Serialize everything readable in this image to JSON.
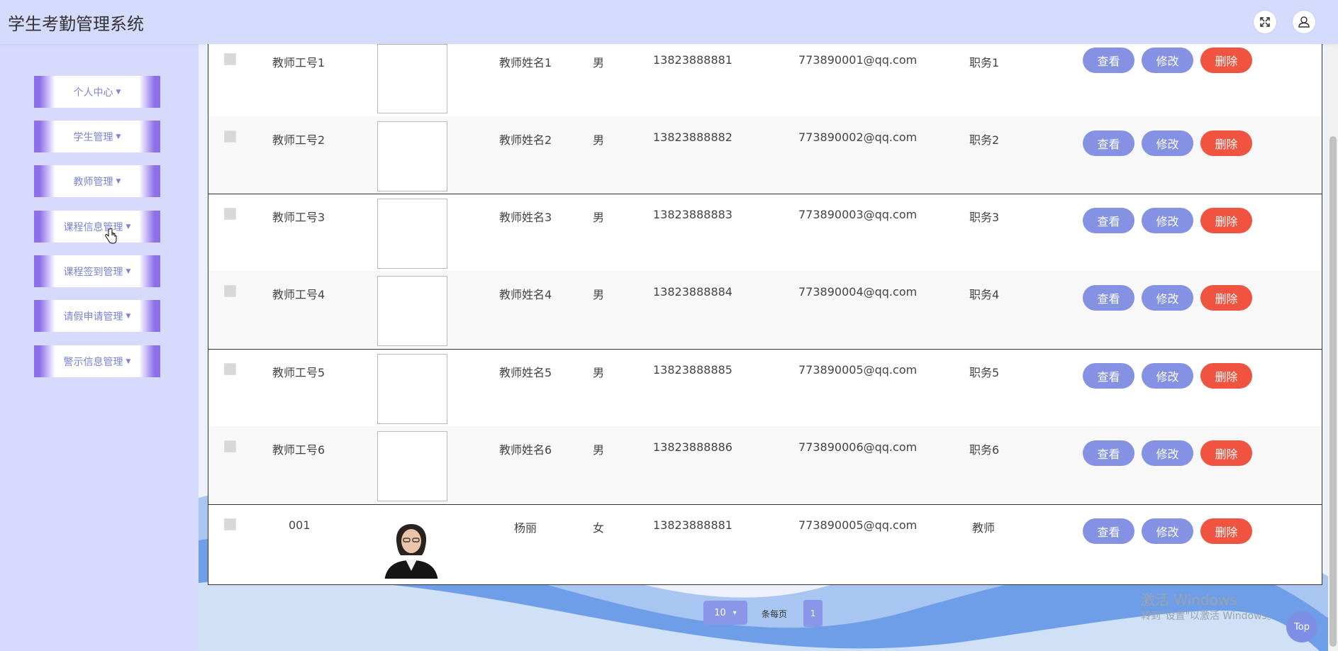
{
  "header": {
    "title": "学生考勤管理系统",
    "fullscreen_icon": "expand-icon",
    "user_icon": "user-icon"
  },
  "sidebar": {
    "items": [
      {
        "label": "个人中心"
      },
      {
        "label": "学生管理"
      },
      {
        "label": "教师管理"
      },
      {
        "label": "课程信息管理"
      },
      {
        "label": "课程签到管理"
      },
      {
        "label": "请假申请管理"
      },
      {
        "label": "警示信息管理"
      }
    ]
  },
  "table": {
    "rows": [
      {
        "id": "教师工号1",
        "name": "教师姓名1",
        "gender": "男",
        "phone": "13823888881",
        "email": "773890001@qq.com",
        "title": "职务1"
      },
      {
        "id": "教师工号2",
        "name": "教师姓名2",
        "gender": "男",
        "phone": "13823888882",
        "email": "773890002@qq.com",
        "title": "职务2"
      },
      {
        "id": "教师工号3",
        "name": "教师姓名3",
        "gender": "男",
        "phone": "13823888883",
        "email": "773890003@qq.com",
        "title": "职务3"
      },
      {
        "id": "教师工号4",
        "name": "教师姓名4",
        "gender": "男",
        "phone": "13823888884",
        "email": "773890004@qq.com",
        "title": "职务4"
      },
      {
        "id": "教师工号5",
        "name": "教师姓名5",
        "gender": "男",
        "phone": "13823888885",
        "email": "773890005@qq.com",
        "title": "职务5"
      },
      {
        "id": "教师工号6",
        "name": "教师姓名6",
        "gender": "男",
        "phone": "13823888886",
        "email": "773890006@qq.com",
        "title": "职务6"
      },
      {
        "id": "001",
        "name": "杨丽",
        "gender": "女",
        "phone": "13823888881",
        "email": "773890005@qq.com",
        "title": "教师"
      }
    ],
    "actions": {
      "view": "查看",
      "edit": "修改",
      "delete": "删除"
    }
  },
  "pagination": {
    "page_size": "10",
    "per_page_label": "条每页",
    "current_page": "1"
  },
  "watermark": {
    "line1": "激活 Windows",
    "line2": "转到\"设置\"以激活 Windows。"
  },
  "top_button": "Top",
  "colors": {
    "header_bg": "#d5dbfd",
    "sidebar_bg": "#d6dafc",
    "accent": "#8592e3",
    "danger": "#f0533f",
    "menu_border": "#8c6fe9"
  }
}
